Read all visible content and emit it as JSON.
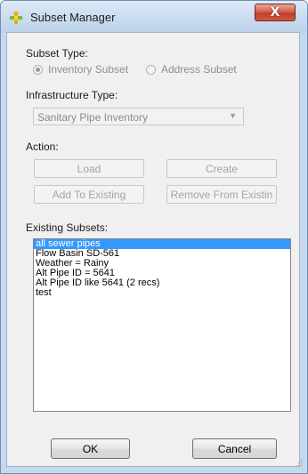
{
  "window": {
    "title": "Subset Manager",
    "close_label": "X"
  },
  "subset_type": {
    "label": "Subset Type:",
    "options": [
      {
        "label": "Inventory Subset",
        "selected": true
      },
      {
        "label": "Address Subset",
        "selected": false
      }
    ]
  },
  "infrastructure": {
    "label": "Infrastructure Type:",
    "selected": "Sanitary Pipe Inventory"
  },
  "action": {
    "label": "Action:",
    "load": "Load",
    "create": "Create",
    "add_to_existing": "Add To Existing",
    "remove_from_existing": "Remove From Existin"
  },
  "existing": {
    "label": "Existing Subsets:",
    "items": [
      "all sewer pipes",
      "Flow Basin SD-561",
      "Weather = Rainy",
      "Alt Pipe ID = 5641",
      "Alt Pipe ID like 5641 (2 recs)",
      "test"
    ],
    "selected_index": 0
  },
  "footer": {
    "ok": "OK",
    "cancel": "Cancel"
  },
  "colors": {
    "selection": "#3399ff",
    "titlebar": "#c9dcf0",
    "close": "#c1402b"
  }
}
